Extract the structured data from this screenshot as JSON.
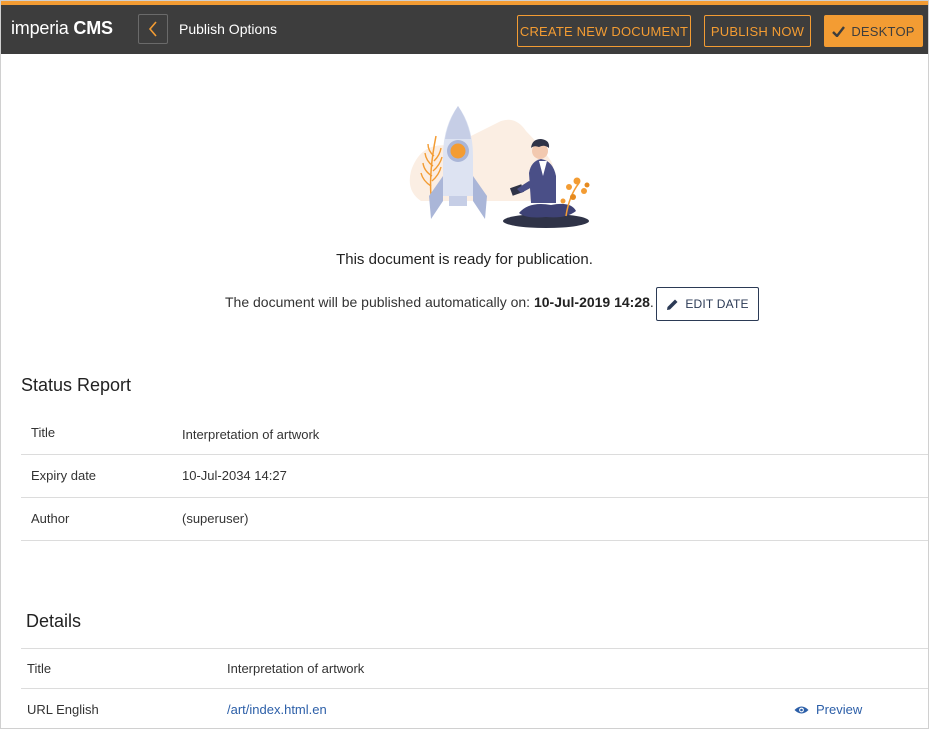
{
  "header": {
    "logo_light": "imperia ",
    "logo_bold": "CMS",
    "title": "Publish Options",
    "buttons": {
      "create": "CREATE NEW DOCUMENT",
      "publish": "PUBLISH NOW",
      "desktop": "DESKTOP"
    }
  },
  "hero": {
    "ready_text": "This document is ready for publication.",
    "auto_publish_prefix": "The document will be published automatically on: ",
    "auto_publish_date": "10-Jul-2019 14:28",
    "auto_publish_suffix": ".",
    "edit_date_label": "EDIT DATE"
  },
  "status_report": {
    "title": "Status Report",
    "rows": [
      {
        "label": "Title",
        "value": "Interpretation of artwork"
      },
      {
        "label": "Expiry date",
        "value": "10-Jul-2034 14:27"
      },
      {
        "label": "Author",
        "value": "(superuser)"
      }
    ]
  },
  "details": {
    "title": "Details",
    "rows": [
      {
        "label": "Title",
        "value": "Interpretation of artwork"
      },
      {
        "label": "URL English",
        "value": "/art/index.html.en",
        "action": "Preview"
      }
    ]
  },
  "colors": {
    "accent": "#f39c33",
    "topbar": "#3d3d3d",
    "navy": "#2b3a55",
    "link": "#2c5fa8"
  },
  "icons": {
    "back": "chevron-left-icon",
    "check": "check-icon",
    "pencil": "pencil-icon",
    "eye": "eye-icon"
  }
}
